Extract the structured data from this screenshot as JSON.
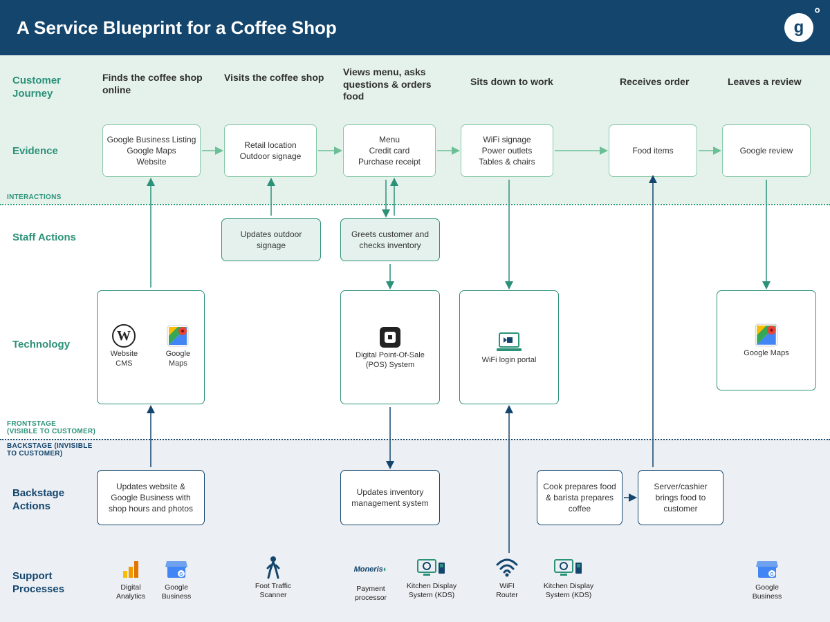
{
  "title": "A Service Blueprint for a Coffee Shop",
  "lanes": {
    "journey": "Customer Journey",
    "evidence": "Evidence",
    "staff": "Staff Actions",
    "technology": "Technology",
    "backstage": "Backstage Actions",
    "support": "Support Processes"
  },
  "separators": {
    "interactions": "INTERACTIONS",
    "frontstage": "FRONTSTAGE\n(VISIBLE TO CUSTOMER)",
    "backstage": "BACKSTAGE (INVISIBLE\nTO CUSTOMER)"
  },
  "stages": [
    {
      "header": "Finds the coffee shop online",
      "evidence": "Google Business Listing\nGoogle Maps\nWebsite",
      "staff": null,
      "tech": [
        {
          "label": "Website CMS",
          "icon": "wordpress"
        },
        {
          "label": "Google Maps",
          "icon": "gmaps"
        }
      ],
      "backstage": "Updates website & Google Business with shop hours and photos",
      "support": [
        {
          "label": "Digital Analytics",
          "icon": "analytics"
        },
        {
          "label": "Google Business",
          "icon": "gbusiness"
        }
      ]
    },
    {
      "header": "Visits the coffee shop",
      "evidence": "Retail location\nOutdoor signage",
      "staff": "Updates outdoor signage",
      "tech": null,
      "backstage": null,
      "support": [
        {
          "label": "Foot Traffic Scanner",
          "icon": "walker"
        }
      ]
    },
    {
      "header": "Views menu, asks questions & orders food",
      "evidence": "Menu\nCredit card\nPurchase receipt",
      "staff": "Greets customer and checks inventory",
      "tech": [
        {
          "label": "Digital Point-Of-Sale (POS) System",
          "icon": "square"
        }
      ],
      "backstage": "Updates inventory management system",
      "support": [
        {
          "label": "Payment processor",
          "icon": "moneris"
        },
        {
          "label": "Kitchen Display System (KDS)",
          "icon": "kds"
        }
      ]
    },
    {
      "header": "Sits down to work",
      "evidence": "WiFi signage\nPower outlets\nTables & chairs",
      "staff": null,
      "tech": [
        {
          "label": "WiFi login portal",
          "icon": "laptop"
        }
      ],
      "backstage": null,
      "support": [
        {
          "label": "WiFI Router",
          "icon": "wifi"
        },
        {
          "label": "Kitchen Display System (KDS)",
          "icon": "kds"
        }
      ]
    },
    {
      "header": "Receives order",
      "evidence": "Food items",
      "staff": null,
      "tech": null,
      "backstage_a": "Cook prepares food & barista prepares coffee",
      "backstage_b": "Server/cashier brings food to customer",
      "support": []
    },
    {
      "header": "Leaves a review",
      "evidence": "Google review",
      "staff": null,
      "tech": [
        {
          "label": "Google Maps",
          "icon": "gmaps"
        }
      ],
      "backstage": null,
      "support": [
        {
          "label": "Google Business",
          "icon": "gbusiness"
        }
      ]
    }
  ]
}
